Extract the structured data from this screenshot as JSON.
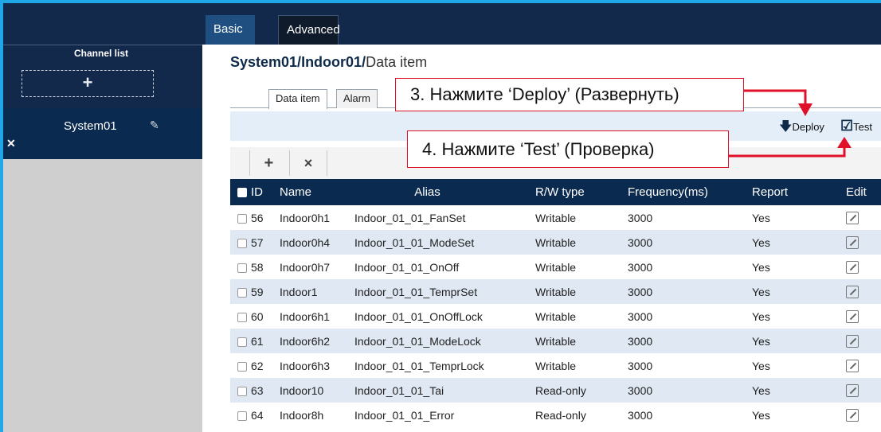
{
  "top_tabs": {
    "basic": "Basic",
    "advanced": "Advanced"
  },
  "sidebar": {
    "title": "Channel list",
    "add_symbol": "+",
    "items": [
      {
        "label": "System01"
      }
    ]
  },
  "breadcrumb": {
    "part1": "System01/",
    "part2": "Indoor01/",
    "current": "Data item"
  },
  "subtabs": {
    "data_item": "Data item",
    "alarm": "Alarm"
  },
  "actions": {
    "deploy": "Deploy",
    "test": "Test"
  },
  "toolbar": {
    "add": "+",
    "delete": "×"
  },
  "table": {
    "headers": {
      "id": "ID",
      "name": "Name",
      "alias": "Alias",
      "rw": "R/W type",
      "freq": "Frequency(ms)",
      "report": "Report",
      "edit": "Edit"
    },
    "rows": [
      {
        "id": "56",
        "name": "Indoor0h1",
        "alias": "Indoor_01_01_FanSet",
        "rw": "Writable",
        "freq": "3000",
        "report": "Yes"
      },
      {
        "id": "57",
        "name": "Indoor0h4",
        "alias": "Indoor_01_01_ModeSet",
        "rw": "Writable",
        "freq": "3000",
        "report": "Yes"
      },
      {
        "id": "58",
        "name": "Indoor0h7",
        "alias": "Indoor_01_01_OnOff",
        "rw": "Writable",
        "freq": "3000",
        "report": "Yes"
      },
      {
        "id": "59",
        "name": "Indoor1",
        "alias": "Indoor_01_01_TemprSet",
        "rw": "Writable",
        "freq": "3000",
        "report": "Yes"
      },
      {
        "id": "60",
        "name": "Indoor6h1",
        "alias": "Indoor_01_01_OnOffLock",
        "rw": "Writable",
        "freq": "3000",
        "report": "Yes"
      },
      {
        "id": "61",
        "name": "Indoor6h2",
        "alias": "Indoor_01_01_ModeLock",
        "rw": "Writable",
        "freq": "3000",
        "report": "Yes"
      },
      {
        "id": "62",
        "name": "Indoor6h3",
        "alias": "Indoor_01_01_TemprLock",
        "rw": "Writable",
        "freq": "3000",
        "report": "Yes"
      },
      {
        "id": "63",
        "name": "Indoor10",
        "alias": "Indoor_01_01_Tai",
        "rw": "Read-only",
        "freq": "3000",
        "report": "Yes"
      },
      {
        "id": "64",
        "name": "Indoor8h",
        "alias": "Indoor_01_01_Error",
        "rw": "Read-only",
        "freq": "3000",
        "report": "Yes"
      }
    ]
  },
  "annotations": {
    "step3": "3. Нажмите ‘Deploy’ (Развернуть)",
    "step4": "4. Нажмите ‘Test’ (Проверка)"
  },
  "colors": {
    "header_navy": "#12294b",
    "frame_blue": "#1fa7e8",
    "annotation_red": "#e0102a",
    "row_alt": "#dfe8f3"
  }
}
